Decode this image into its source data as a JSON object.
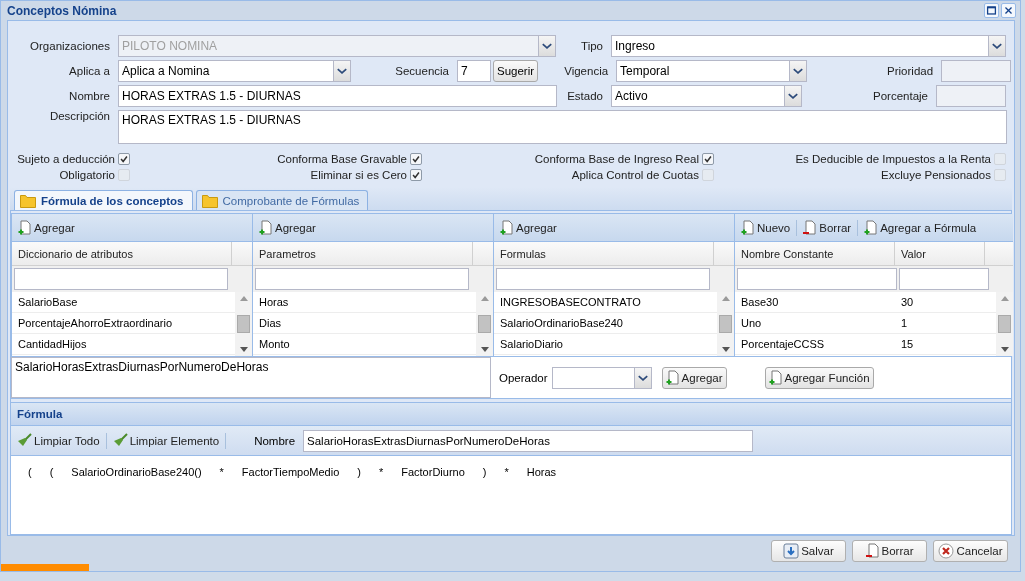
{
  "window": {
    "title": "Conceptos Nómina"
  },
  "form": {
    "organizaciones": {
      "label": "Organizaciones",
      "value": "PILOTO NOMINA",
      "disabled": true
    },
    "tipo": {
      "label": "Tipo",
      "value": "Ingreso"
    },
    "aplica_a": {
      "label": "Aplica a",
      "value": "Aplica a Nomina"
    },
    "secuencia": {
      "label": "Secuencia",
      "value": "7",
      "button": "Sugerir"
    },
    "vigencia": {
      "label": "Vigencia",
      "value": "Temporal"
    },
    "prioridad": {
      "label": "Prioridad",
      "disabled": true
    },
    "nombre": {
      "label": "Nombre",
      "value": "HORAS EXTRAS 1.5 - DIURNAS"
    },
    "estado": {
      "label": "Estado",
      "value": "Activo"
    },
    "porcentaje": {
      "label": "Porcentaje",
      "disabled": true
    },
    "descripcion": {
      "label": "Descripción",
      "value": "HORAS EXTRAS 1.5 - DIURNAS"
    }
  },
  "checkboxes": [
    {
      "label": "Sujeto a deducción",
      "checked": true
    },
    {
      "label": "Conforma Base Gravable",
      "checked": true
    },
    {
      "label": "Conforma Base de Ingreso Real",
      "checked": true
    },
    {
      "label": "Es Deducible de Impuestos a la Renta",
      "checked": false
    },
    {
      "label": "Obligatorio",
      "checked": false
    },
    {
      "label": "Eliminar si es Cero",
      "checked": true
    },
    {
      "label": "Aplica Control de Cuotas",
      "checked": false
    },
    {
      "label": "Excluye Pensionados",
      "checked": false
    }
  ],
  "tabs": [
    {
      "label": "Fórmula de los conceptos",
      "selected": true
    },
    {
      "label": "Comprobante de Fórmulas",
      "selected": false
    }
  ],
  "grids": [
    {
      "toolbar": [
        {
          "label": "Agregar",
          "kind": "add"
        }
      ],
      "columns": [
        "Diccionario de atributos"
      ],
      "rows": [
        [
          "SalarioBase"
        ],
        [
          "PorcentajeAhorroExtraordinario"
        ],
        [
          "CantidadHijos"
        ]
      ]
    },
    {
      "toolbar": [
        {
          "label": "Agregar",
          "kind": "add"
        }
      ],
      "columns": [
        "Parametros"
      ],
      "rows": [
        [
          "Horas"
        ],
        [
          "Dias"
        ],
        [
          "Monto"
        ]
      ]
    },
    {
      "toolbar": [
        {
          "label": "Agregar",
          "kind": "add"
        }
      ],
      "columns": [
        "Formulas"
      ],
      "rows": [
        [
          "INGRESOBASECONTRATO"
        ],
        [
          "SalarioOrdinarioBase240"
        ],
        [
          "SalarioDiario"
        ]
      ]
    },
    {
      "toolbar": [
        {
          "label": "Nuevo",
          "kind": "add"
        },
        {
          "label": "Borrar",
          "kind": "remove"
        },
        {
          "label": "Agregar a Fórmula",
          "kind": "add"
        }
      ],
      "columns": [
        "Nombre Constante",
        "Valor"
      ],
      "rows": [
        [
          "Base30",
          "30"
        ],
        [
          "Uno",
          "1"
        ],
        [
          "PorcentajeCCSS",
          "15"
        ]
      ]
    }
  ],
  "expression": {
    "value": "SalarioHorasExtrasDiurnasPorNumeroDeHoras"
  },
  "operator": {
    "label": "Operador"
  },
  "expression_buttons": [
    {
      "label": "Agregar",
      "kind": "add"
    },
    {
      "label": "Agregar Función",
      "kind": "add"
    }
  ],
  "formula": {
    "title": "Fórmula",
    "tools": [
      "Limpiar Todo",
      "Limpiar Elemento"
    ],
    "name_label": "Nombre",
    "name_value": "SalarioHorasExtrasDiurnasPorNumeroDeHoras",
    "tokens": [
      "(",
      "(",
      "SalarioOrdinarioBase240()",
      "*",
      "FactorTiempoMedio",
      ")",
      "*",
      "FactorDiurno",
      ")",
      "*",
      "Horas"
    ]
  },
  "footer_buttons": [
    {
      "label": "Salvar",
      "kind": "save"
    },
    {
      "label": "Borrar",
      "kind": "remove"
    },
    {
      "label": "Cancelar",
      "kind": "cancel"
    }
  ]
}
